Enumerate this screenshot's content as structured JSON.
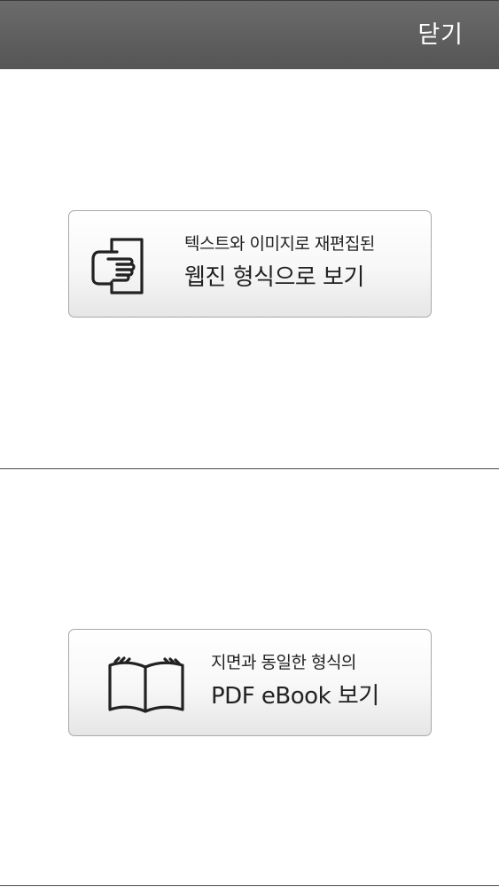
{
  "header": {
    "close_label": "닫기"
  },
  "options": {
    "webzine": {
      "line1": "텍스트와 이미지로 재편집된",
      "line2": "웹진 형식으로 보기",
      "icon": "hand-document-icon"
    },
    "pdf": {
      "line1": "지면과 동일한 형식의",
      "line2": "PDF eBook 보기",
      "icon": "open-book-icon"
    }
  },
  "colors": {
    "header_bg": "#5e5e5e",
    "header_text": "#ffffff",
    "button_border": "#a8a8a8",
    "text": "#222222"
  }
}
